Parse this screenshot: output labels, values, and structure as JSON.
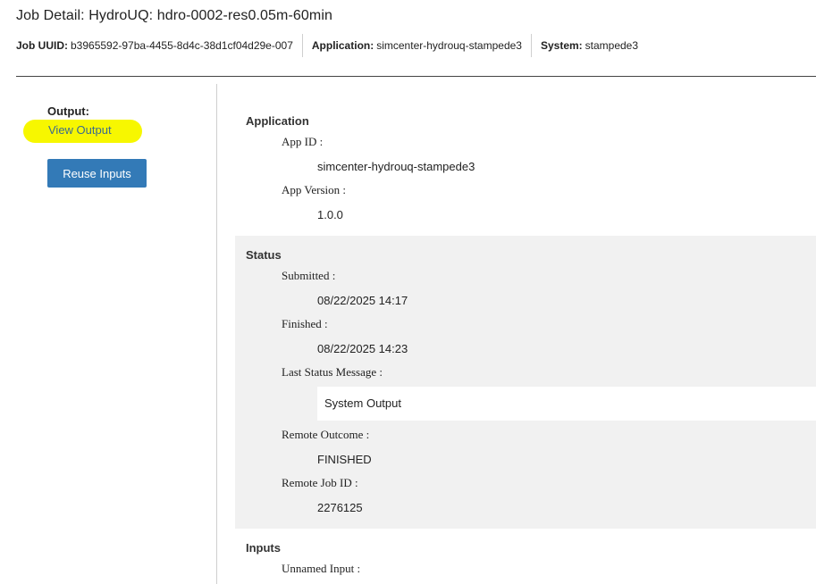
{
  "header": {
    "title": "Job Detail: HydroUQ: hdro-0002-res0.05m-60min",
    "uuid_label": "Job UUID:",
    "uuid_value": "b3965592-97ba-4455-8d4c-38d1cf04d29e-007",
    "application_label": "Application:",
    "application_value": "simcenter-hydrouq-stampede3",
    "system_label": "System:",
    "system_value": "stampede3"
  },
  "left_panel": {
    "output_label": "Output:",
    "view_output_link": "View Output",
    "reuse_inputs_button": "Reuse Inputs",
    "highlight_color": "#f7f700"
  },
  "application_section": {
    "title": "Application",
    "app_id_label": "App ID :",
    "app_id_value": "simcenter-hydrouq-stampede3",
    "app_version_label": "App Version :",
    "app_version_value": "1.0.0"
  },
  "status_section": {
    "title": "Status",
    "submitted_label": "Submitted :",
    "submitted_value": "08/22/2025 14:17",
    "finished_label": "Finished :",
    "finished_value": "08/22/2025 14:23",
    "last_status_label": "Last Status Message :",
    "last_status_value": "System Output",
    "remote_outcome_label": "Remote Outcome :",
    "remote_outcome_value": "FINISHED",
    "remote_job_id_label": "Remote Job ID :",
    "remote_job_id_value": "2276125"
  },
  "inputs_section": {
    "title": "Inputs",
    "unnamed_input_label": "Unnamed Input :"
  },
  "colors": {
    "primary_button": "#337ab7",
    "link": "#3b6b8f",
    "status_background": "#f1f1f1"
  }
}
